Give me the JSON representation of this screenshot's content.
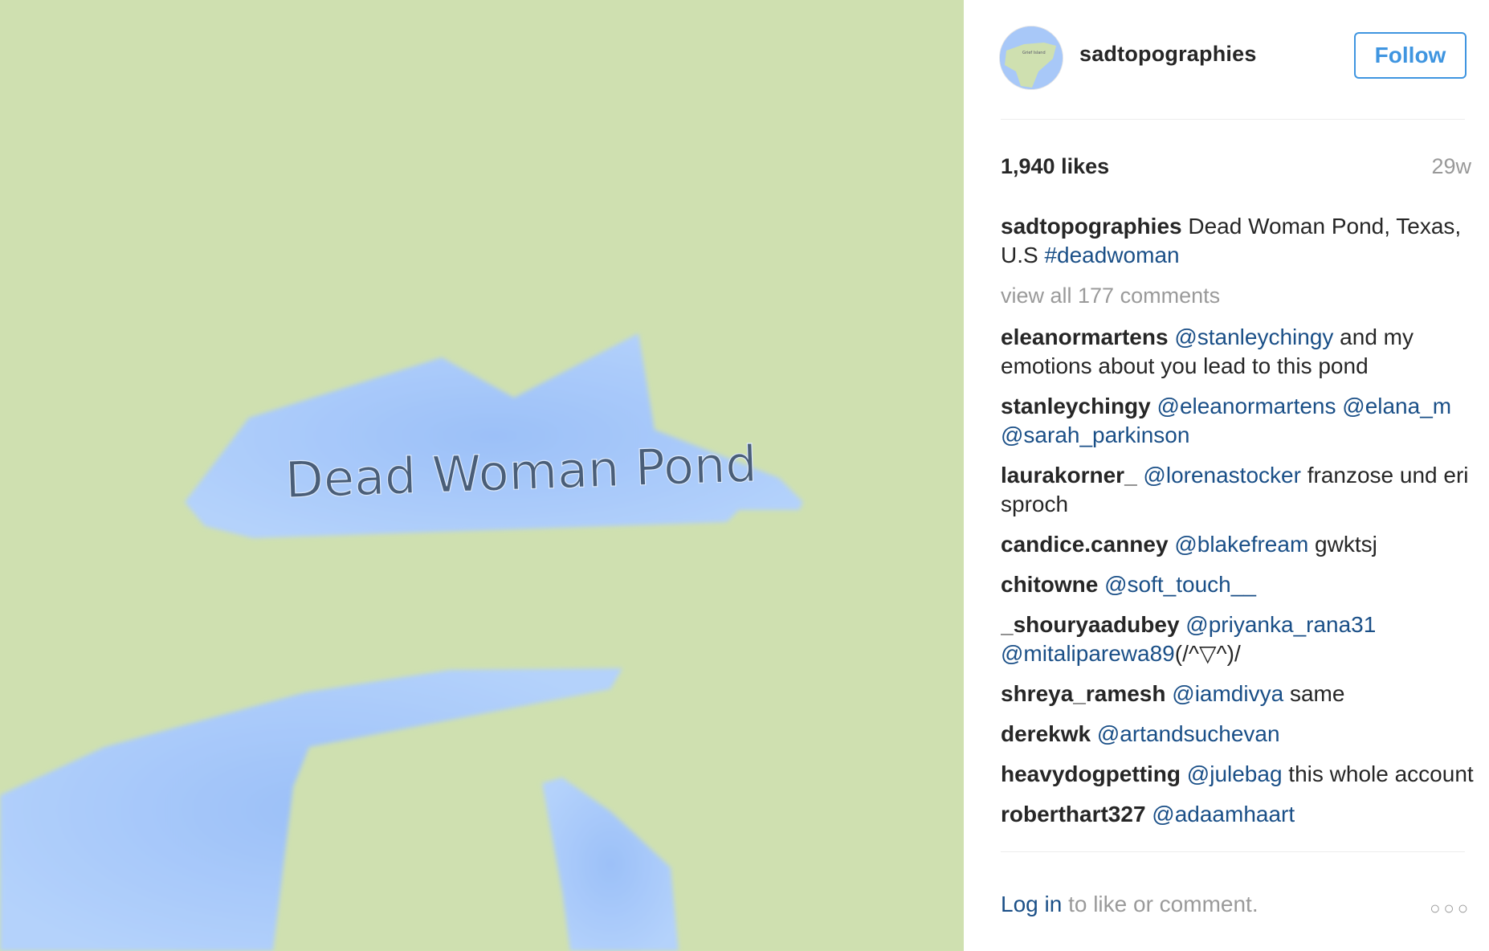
{
  "photo": {
    "label": "Dead Woman Pond",
    "land_color": "#cfe0b0",
    "water_color": "#a6c8fa"
  },
  "header": {
    "username": "sadtopographies",
    "follow_label": "Follow",
    "avatar_icon": "map-avatar-icon"
  },
  "stats": {
    "likes": "1,940 likes",
    "age": "29w"
  },
  "caption": {
    "author": "sadtopographies",
    "text": " Dead Woman Pond, Texas, U.S ",
    "tag": "#deadwoman"
  },
  "view_all": "view all 177 comments",
  "comments": [
    {
      "author": "eleanormartens",
      "mentions": " @stanleychingy",
      "text": " and my emotions about you lead to this pond"
    },
    {
      "author": "stanleychingy",
      "mentions": " @eleanormartens @elana_m @sarah_parkinson",
      "text": ""
    },
    {
      "author": "laurakorner_",
      "mentions": " @lorenastocker",
      "text": " franzose und eri sproch"
    },
    {
      "author": "candice.canney",
      "mentions": " @blakefream",
      "text": " gwktsj"
    },
    {
      "author": "chitowne",
      "mentions": " @soft_touch__",
      "text": ""
    },
    {
      "author": "_shouryaadubey",
      "mentions": " @priyanka_rana31 @mitaliparewa89",
      "text": "(/^▽^)/"
    },
    {
      "author": "shreya_ramesh",
      "mentions": " @iamdivya",
      "text": " same"
    },
    {
      "author": "derekwk",
      "mentions": " @artandsuchevan",
      "text": ""
    },
    {
      "author": "heavydogpetting",
      "mentions": " @julebag",
      "text": " this whole account"
    },
    {
      "author": "roberthart327",
      "mentions": " @adaamhaart",
      "text": ""
    }
  ],
  "footer": {
    "login": "Log in",
    "rest": " to like or comment.",
    "more_icon": "more-options-icon"
  }
}
